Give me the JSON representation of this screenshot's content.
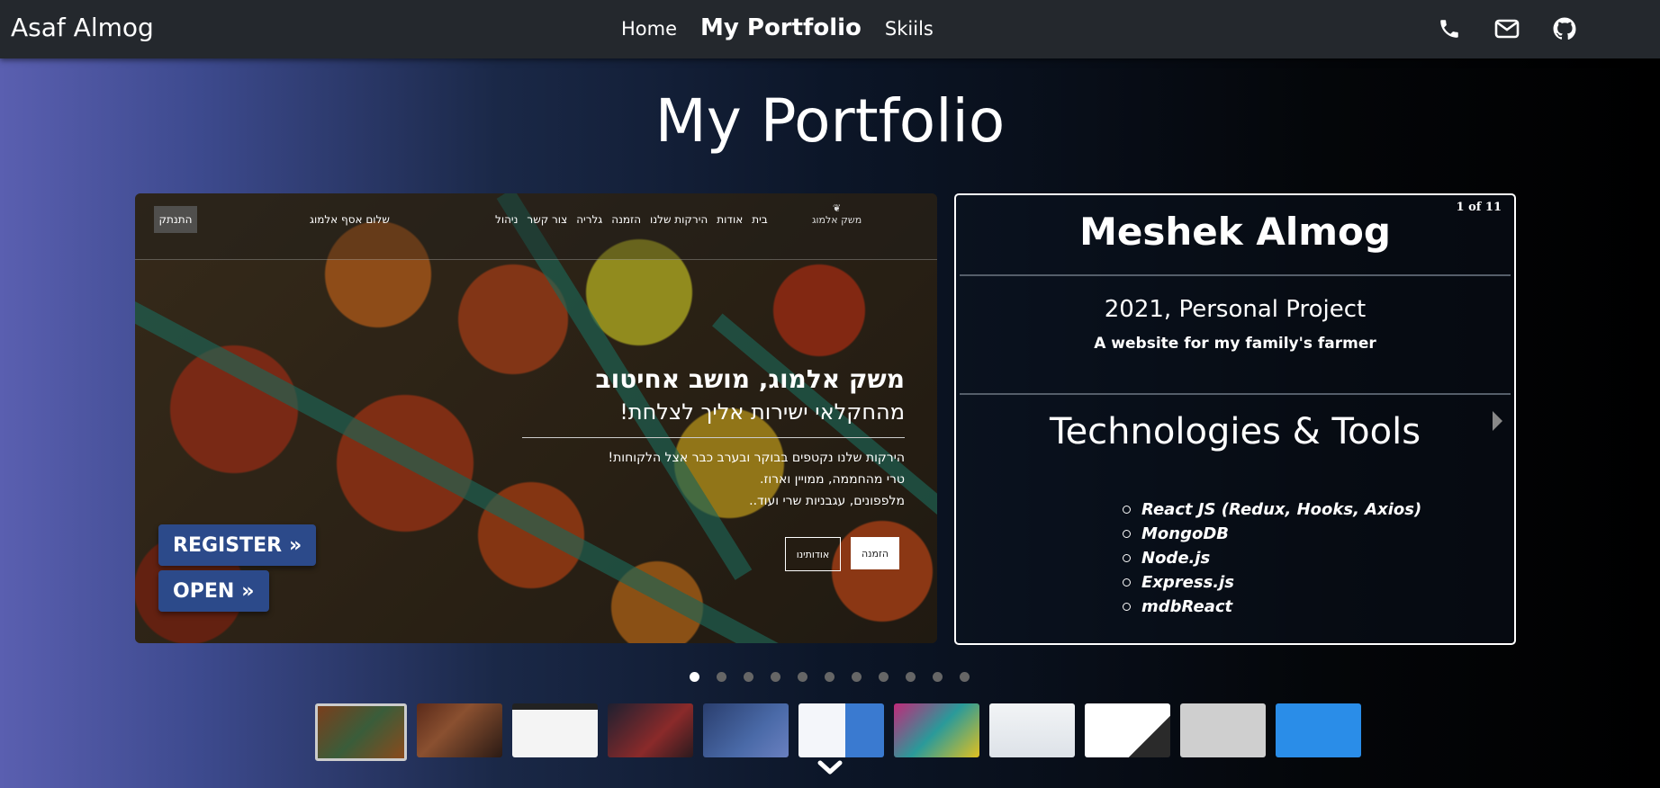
{
  "navbar": {
    "brand": "Asaf Almog",
    "links": [
      "Home",
      "My Portfolio",
      "Skiils"
    ],
    "icons": [
      "phone-icon",
      "envelope-icon",
      "github-icon"
    ]
  },
  "page_title": "My Portfolio",
  "slide": {
    "site_nav": {
      "logout": "התנתק",
      "greeting": "שלום אסף אלמוג",
      "links": [
        "בית",
        "אודות",
        "הירקות שלנו",
        "הזמנה",
        "גלריה",
        "צור קשר",
        "ניהול"
      ],
      "logo_text": "משק אלמוג"
    },
    "hero_title": "משק אלמוג, מושב אחיטוב",
    "hero_subtitle": "מהחקלאי ישירות אליך לצלחת!",
    "hero_lines": [
      "הירקות שלנו נקטפים בבוקר ובערב כבר אצל הלקוחות!",
      "טרי מהחממה, ממויין וארוז.",
      "מלפפונים, עגבניות שרי ועוד.."
    ],
    "order_button": "הזמנה",
    "about_button": "אודותינו"
  },
  "actions": {
    "register": "REGISTER",
    "open": "OPEN"
  },
  "project": {
    "counter": "1 of 11",
    "title": "Meshek Almog",
    "year_type": "2021, Personal Project",
    "description": "A website for my family's farmer",
    "tech_heading": "Technologies & Tools",
    "tech_list": [
      "React JS (Redux, Hooks, Axios)",
      "MongoDB",
      "Node.js",
      "Express.js",
      "mdbReact"
    ]
  },
  "carousel": {
    "slide_count": 11,
    "active_index": 0
  },
  "colors": {
    "navbar_bg": "#24282d",
    "action_button": "#2c4a8a",
    "gradient_start": "#5a5fb0",
    "gradient_end": "#000000"
  }
}
